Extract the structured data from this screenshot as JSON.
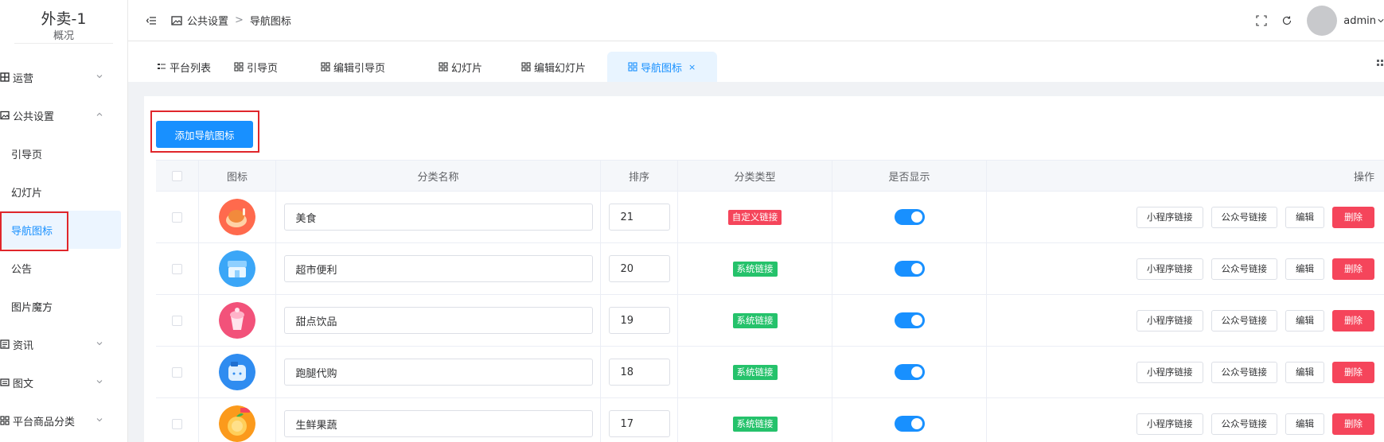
{
  "sidebar": {
    "brand_title": "外卖-1",
    "brand_sub": "概况",
    "items": [
      {
        "label": "运营",
        "icon": "grid-icon"
      },
      {
        "label": "公共设置",
        "icon": "image-icon"
      },
      {
        "label": "引导页"
      },
      {
        "label": "幻灯片"
      },
      {
        "label": "导航图标"
      },
      {
        "label": "公告"
      },
      {
        "label": "图片魔方"
      },
      {
        "label": "资讯",
        "icon": "news-icon"
      },
      {
        "label": "图文",
        "icon": "picture-text-icon"
      },
      {
        "label": "平台商品分类",
        "icon": "category-icon"
      }
    ]
  },
  "header": {
    "breadcrumb": [
      "公共设置",
      "导航图标"
    ],
    "separator": ">",
    "username": "admin"
  },
  "tabs": [
    {
      "label": "平台列表"
    },
    {
      "label": "引导页"
    },
    {
      "label": "编辑引导页"
    },
    {
      "label": "幻灯片"
    },
    {
      "label": "编辑幻灯片"
    },
    {
      "label": "导航图标",
      "close": "×"
    }
  ],
  "main": {
    "add_button": "添加导航图标",
    "columns": [
      "图标",
      "分类名称",
      "排序",
      "分类类型",
      "是否显示",
      "操作"
    ],
    "rows": [
      {
        "name": "美食",
        "sort": "21",
        "type": "自定义链接",
        "type_color": "#f5455b",
        "icon_color": "#ff6a4d"
      },
      {
        "name": "超市便利",
        "sort": "20",
        "type": "系统链接",
        "type_color": "#25c26b",
        "icon_color": "#3ba6f7"
      },
      {
        "name": "甜点饮品",
        "sort": "19",
        "type": "系统链接",
        "type_color": "#25c26b",
        "icon_color": "#f2527a"
      },
      {
        "name": "跑腿代购",
        "sort": "18",
        "type": "系统链接",
        "type_color": "#25c26b",
        "icon_color": "#2f8cf0"
      },
      {
        "name": "生鲜果蔬",
        "sort": "17",
        "type": "系统链接",
        "type_color": "#25c26b",
        "icon_color": "#fb9a1c"
      }
    ],
    "ops": {
      "mini": "小程序链接",
      "mp": "公众号链接",
      "edit": "编辑",
      "delete": "删除"
    }
  },
  "colors": {
    "primary": "#1890ff",
    "danger": "#f5455b",
    "success": "#25c26b"
  }
}
